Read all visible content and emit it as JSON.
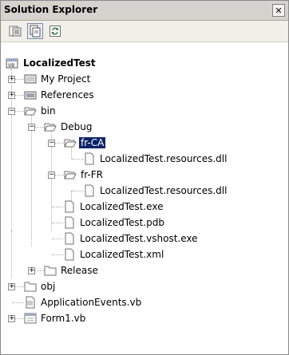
{
  "window": {
    "title": "Solution Explorer",
    "close_glyph": "✕"
  },
  "toolbar": {
    "buttons": [
      {
        "name": "properties-icon"
      },
      {
        "name": "show-all-files-icon",
        "pressed": true
      },
      {
        "name": "refresh-icon"
      }
    ]
  },
  "tree": {
    "project": "LocalizedTest",
    "my_project": "My Project",
    "references": "References",
    "bin": "bin",
    "debug": "Debug",
    "fr_ca": "fr-CA",
    "fr_ca_dll": "LocalizedTest.resources.dll",
    "fr_fr": "fr-FR",
    "fr_fr_dll": "LocalizedTest.resources.dll",
    "exe": "LocalizedTest.exe",
    "pdb": "LocalizedTest.pdb",
    "vshost": "LocalizedTest.vshost.exe",
    "xml": "LocalizedTest.xml",
    "release": "Release",
    "obj": "obj",
    "app_events": "ApplicationEvents.vb",
    "form1": "Form1.vb"
  },
  "colors": {
    "selection": "#0a246a",
    "titlebar": "#d6d3ce"
  }
}
